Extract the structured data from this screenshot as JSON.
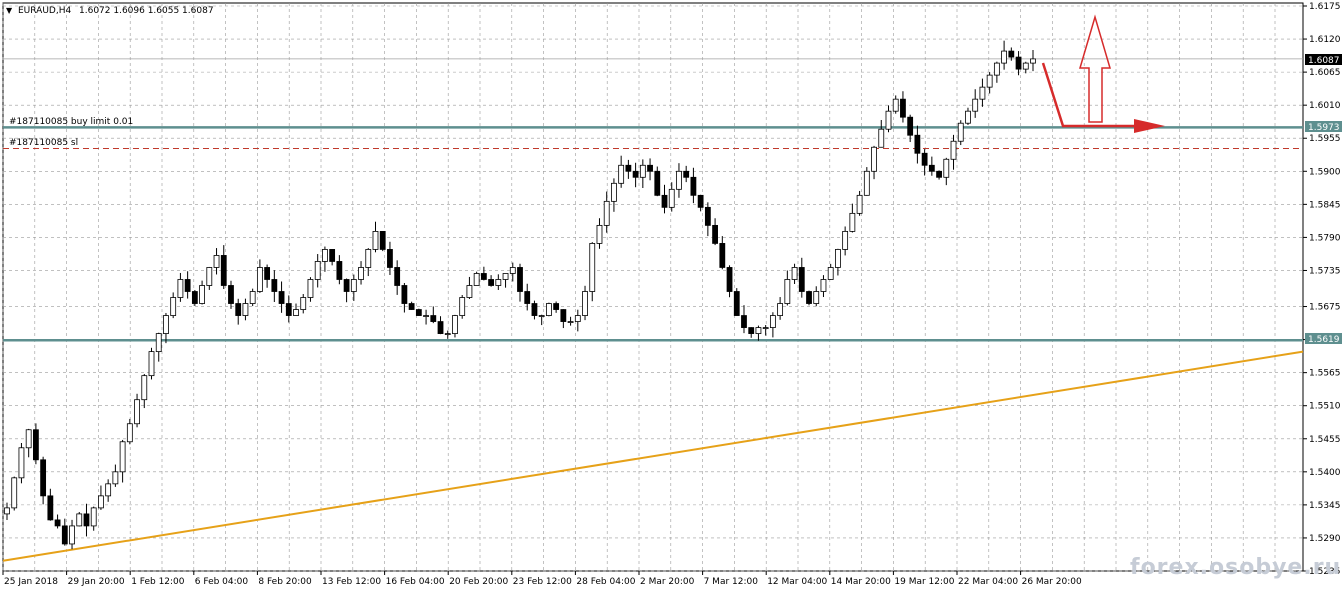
{
  "header": {
    "symbol": "EURAUD,H4",
    "ohlc": "1.6072 1.6096 1.6055 1.6087"
  },
  "watermark": "forex.osobye.ru",
  "orders": {
    "buy_limit": {
      "label": "#187110085 buy limit 0.01",
      "price_label": "1.5973",
      "price": 1.5973
    },
    "sl": {
      "label": "#187110085 sl",
      "price": 1.5938
    }
  },
  "current_price": {
    "label": "1.6087",
    "price": 1.6087
  },
  "support": {
    "label": "1.5619",
    "price": 1.5619
  },
  "colors": {
    "level_line": "#5e8f8f",
    "trendline": "#e6a118",
    "arrows": "#d62b2b",
    "sl_line": "#c0392b",
    "grid": "#9a9a9a"
  },
  "chart_data": {
    "type": "candlestick",
    "title": "",
    "y_ticks": [
      "1.6175",
      "1.6120",
      "1.6065",
      "1.6010",
      "1.5955",
      "1.5900",
      "1.5845",
      "1.5790",
      "1.5735",
      "1.5675",
      "1.5620",
      "1.5565",
      "1.5510",
      "1.5455",
      "1.5400",
      "1.5345",
      "1.5290",
      "1.5235"
    ],
    "x_ticks": [
      "25 Jan 2018",
      "29 Jan 20:00",
      "1 Feb 12:00",
      "6 Feb 04:00",
      "8 Feb 20:00",
      "13 Feb 12:00",
      "16 Feb 04:00",
      "20 Feb 20:00",
      "23 Feb 12:00",
      "28 Feb 04:00",
      "2 Mar 20:00",
      "7 Mar 12:00",
      "12 Mar 04:00",
      "14 Mar 20:00",
      "19 Mar 12:00",
      "22 Mar 04:00",
      "26 Mar 20:00"
    ],
    "ylim": [
      1.5235,
      1.6175
    ],
    "grid": true,
    "series": [
      {
        "values_close_path": [
          1.534,
          1.539,
          1.544,
          1.547,
          1.542,
          1.536,
          1.532,
          1.531,
          1.528,
          1.531,
          1.533,
          1.531,
          1.534,
          1.536,
          1.538,
          1.54,
          1.545,
          1.548,
          1.552,
          1.556,
          1.56,
          1.563,
          1.566,
          1.569,
          1.572,
          1.57,
          1.568,
          1.571,
          1.574,
          1.576,
          1.571,
          1.568,
          1.566,
          1.568,
          1.57,
          1.574,
          1.572,
          1.57,
          1.568,
          1.566,
          1.567,
          1.569,
          1.572,
          1.575,
          1.577,
          1.575,
          1.572,
          1.57,
          1.572,
          1.574,
          1.577,
          1.58,
          1.577,
          1.574,
          1.571,
          1.568,
          1.567,
          1.566,
          1.566,
          1.565,
          1.563,
          1.563,
          1.566,
          1.569,
          1.571,
          1.573,
          1.572,
          1.571,
          1.572,
          1.573,
          1.574,
          1.57,
          1.568,
          1.566,
          1.566,
          1.568,
          1.567,
          1.565,
          1.565,
          1.566,
          1.57,
          1.578,
          1.581,
          1.585,
          1.588,
          1.591,
          1.59,
          1.589,
          1.591,
          1.59,
          1.586,
          1.584,
          1.587,
          1.59,
          1.589,
          1.586,
          1.584,
          1.581,
          1.578,
          1.574,
          1.57,
          1.566,
          1.564,
          1.563,
          1.564,
          1.564,
          1.566,
          1.568,
          1.572,
          1.574,
          1.57,
          1.568,
          1.57,
          1.572,
          1.574,
          1.577,
          1.58,
          1.583,
          1.586,
          1.59,
          1.594,
          1.597,
          1.6,
          1.602,
          1.599,
          1.596,
          1.593,
          1.591,
          1.59,
          1.589,
          1.592,
          1.595,
          1.598,
          1.6,
          1.602,
          1.604,
          1.606,
          1.608,
          1.61,
          1.609,
          1.607,
          1.608,
          1.6087
        ]
      }
    ],
    "annotations": {
      "resistance_level": 1.5973,
      "support_level": 1.5619,
      "trendline": {
        "from": {
          "x": "25 Jan 2018",
          "y": 1.5252
        },
        "to": {
          "x": "26 Mar 20:00",
          "y": 1.56
        }
      }
    }
  }
}
